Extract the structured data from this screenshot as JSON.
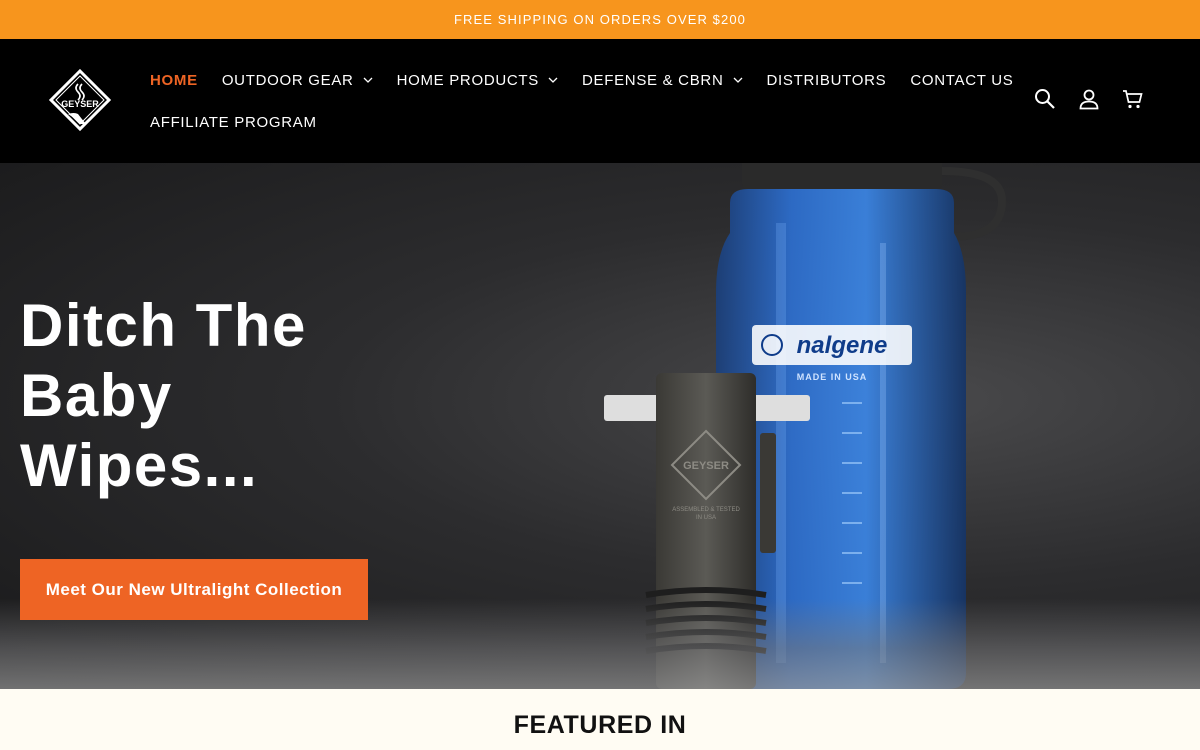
{
  "announcement": {
    "text": "FREE SHIPPING ON ORDERS OVER $200"
  },
  "brand": {
    "logo_text": "GEYSER"
  },
  "nav": {
    "row1": [
      {
        "label": "HOME",
        "active": true,
        "dropdown": false
      },
      {
        "label": "OUTDOOR GEAR",
        "dropdown": true
      },
      {
        "label": "HOME PRODUCTS",
        "dropdown": true
      },
      {
        "label": "DEFENSE & CBRN",
        "dropdown": true
      },
      {
        "label": "DISTRIBUTORS",
        "dropdown": false
      },
      {
        "label": "CONTACT US",
        "dropdown": false
      }
    ],
    "row2": [
      {
        "label": "AFFILIATE PROGRAM",
        "dropdown": false
      }
    ]
  },
  "header_icons": [
    "search-icon",
    "account-icon",
    "cart-icon"
  ],
  "hero": {
    "title_lines": [
      "Ditch The",
      "Baby",
      "Wipes..."
    ],
    "cta_label": "Meet Our New Ultralight Collection",
    "bottle_brand": "nalgene",
    "bottle_subtext": "MADE IN USA",
    "device_brand": "GEYSER",
    "device_subtext_1": "ASSEMBLED & TESTED",
    "device_subtext_2": "IN USA"
  },
  "featured": {
    "title": "FEATURED IN"
  },
  "colors": {
    "announcement_bg": "#f7951d",
    "accent": "#ee6424",
    "header_bg": "#000000",
    "page_bg": "#fffcf3"
  }
}
